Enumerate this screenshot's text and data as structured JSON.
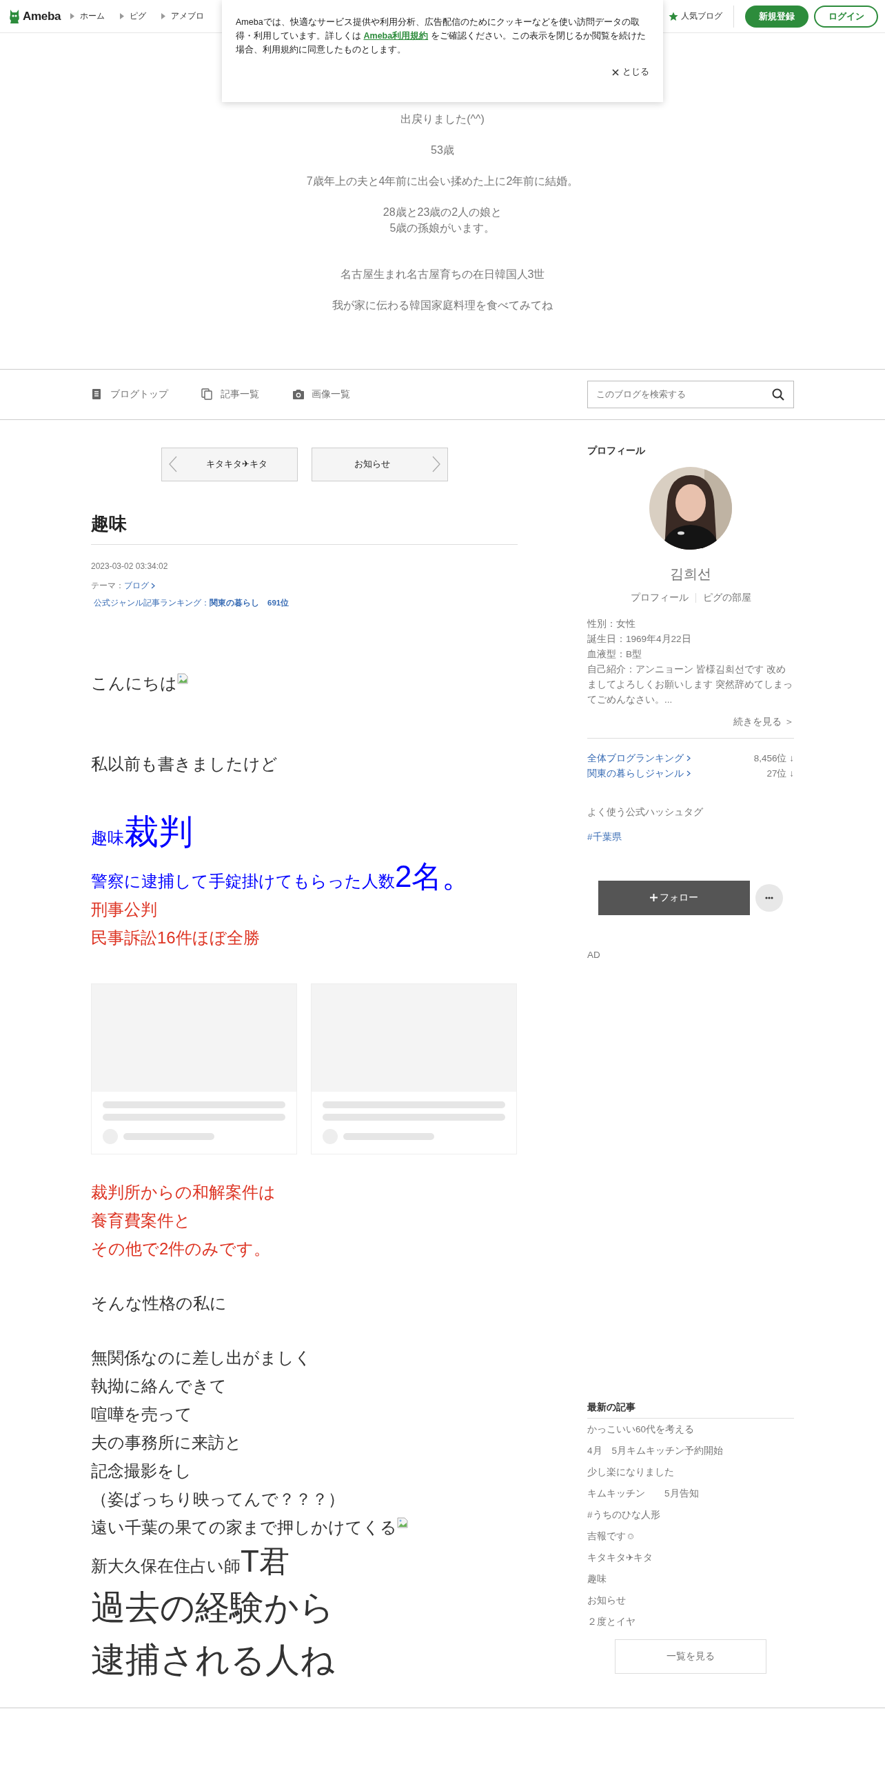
{
  "header": {
    "logo": "Ameba",
    "breadcrumbs": [
      "ホーム",
      "ピグ",
      "アメブロ"
    ],
    "popular": "人気ブログ",
    "signup": "新規登録",
    "login": "ログイン"
  },
  "cookie_banner": {
    "text_before": "Amebaでは、快適なサービス提供や利用分析、広告配信のためにクッキーなどを使い訪問データの取得・利用しています。詳しくは ",
    "link": "Ameba利用規約",
    "text_after": " をご確認ください。この表示を閉じるか閲覧を続けた場合、利用規約に同意したものとします。",
    "close": "とじる"
  },
  "blog": {
    "description": [
      {
        "kind": "line",
        "text": "出戻りました(^^)"
      },
      {
        "kind": "blank"
      },
      {
        "kind": "line",
        "text": "53歳"
      },
      {
        "kind": "blank"
      },
      {
        "kind": "line",
        "text": "7歳年上の夫と4年前に出会い揉めた上に2年前に結婚。"
      },
      {
        "kind": "blank"
      },
      {
        "kind": "line",
        "text": "28歳と23歳の2人の娘と"
      },
      {
        "kind": "line",
        "text": "5歳の孫娘がいます。"
      },
      {
        "kind": "blank"
      },
      {
        "kind": "blank"
      },
      {
        "kind": "line",
        "text": "名古屋生まれ名古屋育ちの在日韓国人3世"
      },
      {
        "kind": "blank"
      },
      {
        "kind": "line",
        "text": "我が家に伝わる韓国家庭料理を食べてみてね"
      }
    ]
  },
  "nav": {
    "items": [
      {
        "label": "ブログトップ"
      },
      {
        "label": "記事一覧"
      },
      {
        "label": "画像一覧"
      }
    ],
    "search": {
      "placeholder": "このブログを検索する"
    }
  },
  "article": {
    "prev": "キタキタ✈キタ",
    "next": "お知らせ",
    "title": "趣味",
    "date": "2023-03-02 03:34:02",
    "theme_label": "テーマ：",
    "theme": "ブログ",
    "ranking_label": "公式ジャンル記事ランキング：",
    "ranking_value": "関東の暮らし　691位",
    "body": [
      {
        "kind": "text",
        "segments": [
          {
            "text": "こんにちは",
            "kind": "normal"
          }
        ],
        "image": true
      },
      {
        "kind": "blank"
      },
      {
        "kind": "blank"
      },
      {
        "kind": "text",
        "segments": [
          {
            "text": "私以前も書きましたけど",
            "kind": "normal"
          }
        ]
      },
      {
        "kind": "blank"
      },
      {
        "kind": "text",
        "segments": [
          {
            "text": "趣味",
            "kind": "normal",
            "color": "#0000ff"
          },
          {
            "text": "裁判",
            "kind": "huge",
            "color": "#0000ff"
          }
        ]
      },
      {
        "kind": "text",
        "segments": [
          {
            "text": "警察に逮捕して手錠掛けてもらった人数",
            "kind": "normal",
            "color": "#0000ff"
          },
          {
            "text": "2名。",
            "kind": "large",
            "color": "#0000ff"
          }
        ]
      },
      {
        "kind": "text",
        "segments": [
          {
            "text": "刑事公判",
            "kind": "normal",
            "color": "#dd3322"
          }
        ]
      },
      {
        "kind": "text",
        "segments": [
          {
            "text": "民事訴訟16件ほぼ全勝",
            "kind": "normal",
            "color": "#dd3322"
          }
        ]
      },
      {
        "kind": "cards"
      },
      {
        "kind": "text",
        "segments": [
          {
            "text": "裁判所からの和解案件は",
            "kind": "normal",
            "color": "#dd3322"
          }
        ]
      },
      {
        "kind": "text",
        "segments": [
          {
            "text": "養育費案件と",
            "kind": "normal",
            "color": "#dd3322"
          }
        ]
      },
      {
        "kind": "text",
        "segments": [
          {
            "text": "その他で2件のみです。",
            "kind": "normal",
            "color": "#dd3322"
          }
        ]
      },
      {
        "kind": "blank"
      },
      {
        "kind": "text",
        "segments": [
          {
            "text": "そんな性格の私に",
            "kind": "normal"
          }
        ]
      },
      {
        "kind": "blank"
      },
      {
        "kind": "text",
        "segments": [
          {
            "text": "無関係なのに差し出がましく",
            "kind": "normal"
          }
        ]
      },
      {
        "kind": "text",
        "segments": [
          {
            "text": "執拗に絡んできて",
            "kind": "normal"
          }
        ]
      },
      {
        "kind": "text",
        "segments": [
          {
            "text": "喧嘩を売って",
            "kind": "normal"
          }
        ]
      },
      {
        "kind": "text",
        "segments": [
          {
            "text": "夫の事務所に来訪と",
            "kind": "normal"
          }
        ]
      },
      {
        "kind": "text",
        "segments": [
          {
            "text": "記念撮影をし",
            "kind": "normal"
          }
        ]
      },
      {
        "kind": "text",
        "segments": [
          {
            "text": "（姿ばっちり映ってんで？？？）",
            "kind": "normal"
          }
        ]
      },
      {
        "kind": "text",
        "segments": [
          {
            "text": "遠い千葉の果ての家まで押しかけてくる",
            "kind": "normal"
          }
        ],
        "image": true
      },
      {
        "kind": "text",
        "segments": [
          {
            "text": "新大久保在住占い師",
            "kind": "normal"
          },
          {
            "text": "T君",
            "kind": "large"
          }
        ]
      },
      {
        "kind": "text",
        "segments": [
          {
            "text": "過去の経験から",
            "kind": "huge"
          }
        ]
      },
      {
        "kind": "text",
        "segments": [
          {
            "text": "逮捕される人ね",
            "kind": "huge"
          }
        ]
      }
    ]
  },
  "sidebar": {
    "profile_heading": "プロフィール",
    "name": "김희선",
    "links": [
      "プロフィール",
      "ピグの部屋"
    ],
    "details": [
      "性別：女性",
      "誕生日：1969年4月22日",
      "血液型：B型",
      "自己紹介：アンニョーン 皆様김희선です 改めましてよろしくお願いします 突然辞めてしまってごめんなさい。..."
    ],
    "more": "続きを見る ＞",
    "rankings": [
      {
        "label": "全体ブログランキング",
        "value": "8,456位 ↓"
      },
      {
        "label": "関東の暮らしジャンル",
        "value": "27位 ↓"
      }
    ],
    "hashtag_heading": "よく使う公式ハッシュタグ",
    "hashtags": [
      "#千葉県"
    ],
    "follow": "フォロー",
    "ad": "AD",
    "latest_heading": "最新の記事",
    "latest": [
      "かっこいい60代を考える",
      "4月　5月キムキッチン予約開始",
      "少し楽になりました",
      "キムキッチン　　5月告知",
      "#うちのひな人形",
      "吉報です☺",
      "キタキタ✈キタ",
      "趣味",
      "お知らせ",
      "２度とイヤ"
    ],
    "see_all": "一覧を見る"
  }
}
